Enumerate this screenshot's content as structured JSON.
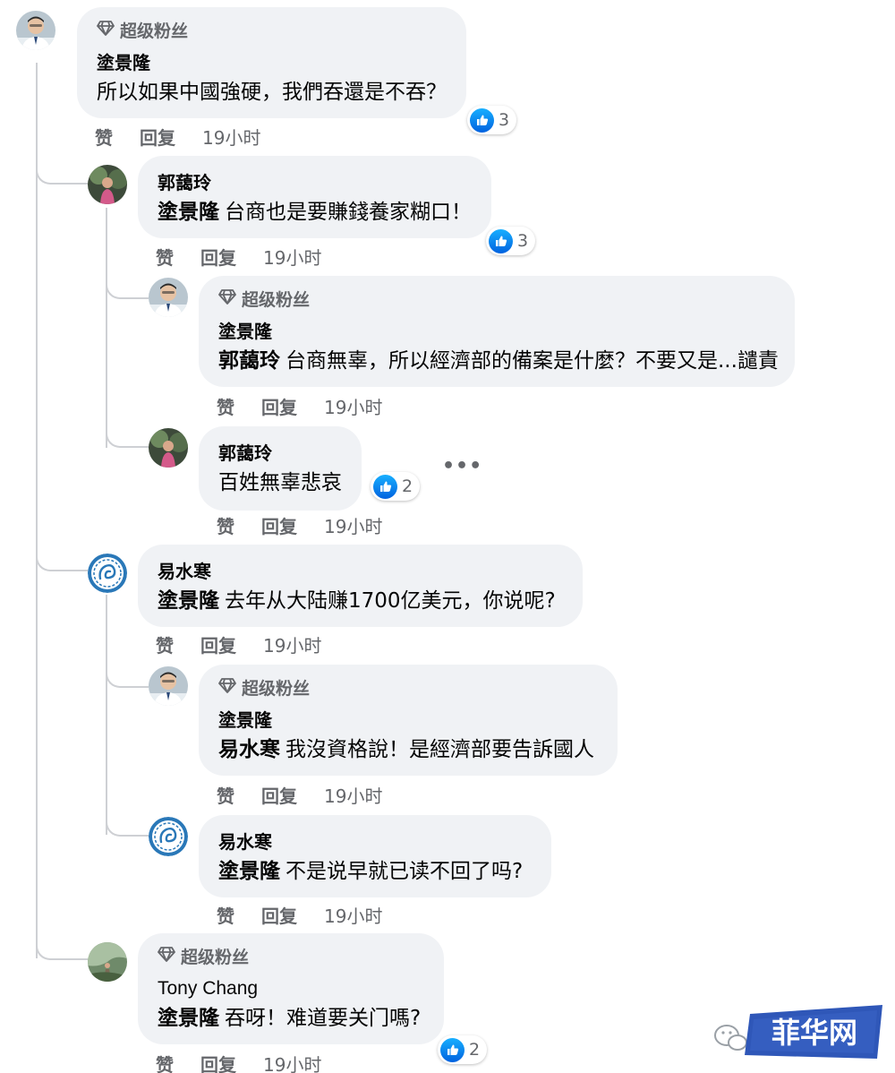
{
  "badge_label": "超级粉丝",
  "actions": {
    "like": "赞",
    "reply": "回复"
  },
  "comments": [
    {
      "author": "塗景隆",
      "badge": "超级粉丝",
      "mention": "",
      "text": "所以如果中國強硬，我們吞還是不吞？",
      "reactions": "3",
      "time": "19小时"
    },
    {
      "author": "郭藹玲",
      "badge": "",
      "mention": "塗景隆",
      "text": "台商也是要賺錢養家糊口！",
      "reactions": "3",
      "time": "19小时"
    },
    {
      "author": "塗景隆",
      "badge": "超级粉丝",
      "mention": "郭藹玲",
      "text": "台商無辜，所以經濟部的備案是什麼？不要又是...譴責",
      "reactions": "",
      "time": "19小时"
    },
    {
      "author": "郭藹玲",
      "badge": "",
      "mention": "",
      "text": "百姓無辜悲哀",
      "reactions": "2",
      "time": "19小时"
    },
    {
      "author": "易水寒",
      "badge": "",
      "mention": "塗景隆",
      "text": "去年从大陆赚1700亿美元，你说呢?",
      "reactions": "",
      "time": "19小时"
    },
    {
      "author": "塗景隆",
      "badge": "超级粉丝",
      "mention": "易水寒",
      "text": "我沒資格說！是經濟部要告訴國人",
      "reactions": "",
      "time": "19小时"
    },
    {
      "author": "易水寒",
      "badge": "",
      "mention": "塗景隆",
      "text": "不是说早就已读不回了吗?",
      "reactions": "",
      "time": "19小时"
    },
    {
      "author": "Tony Chang",
      "badge": "超级粉丝",
      "mention": "塗景隆",
      "text": "吞呀！难道要关门嗎?",
      "reactions": "2",
      "time": "19小时"
    }
  ],
  "more_label": "•••",
  "watermark_text": "菲华网",
  "colors": {
    "bubble": "#f0f2f5",
    "like_blue": "#0866ff",
    "meta_gray": "#65676b",
    "watermark_blue": "#2f57b8"
  }
}
